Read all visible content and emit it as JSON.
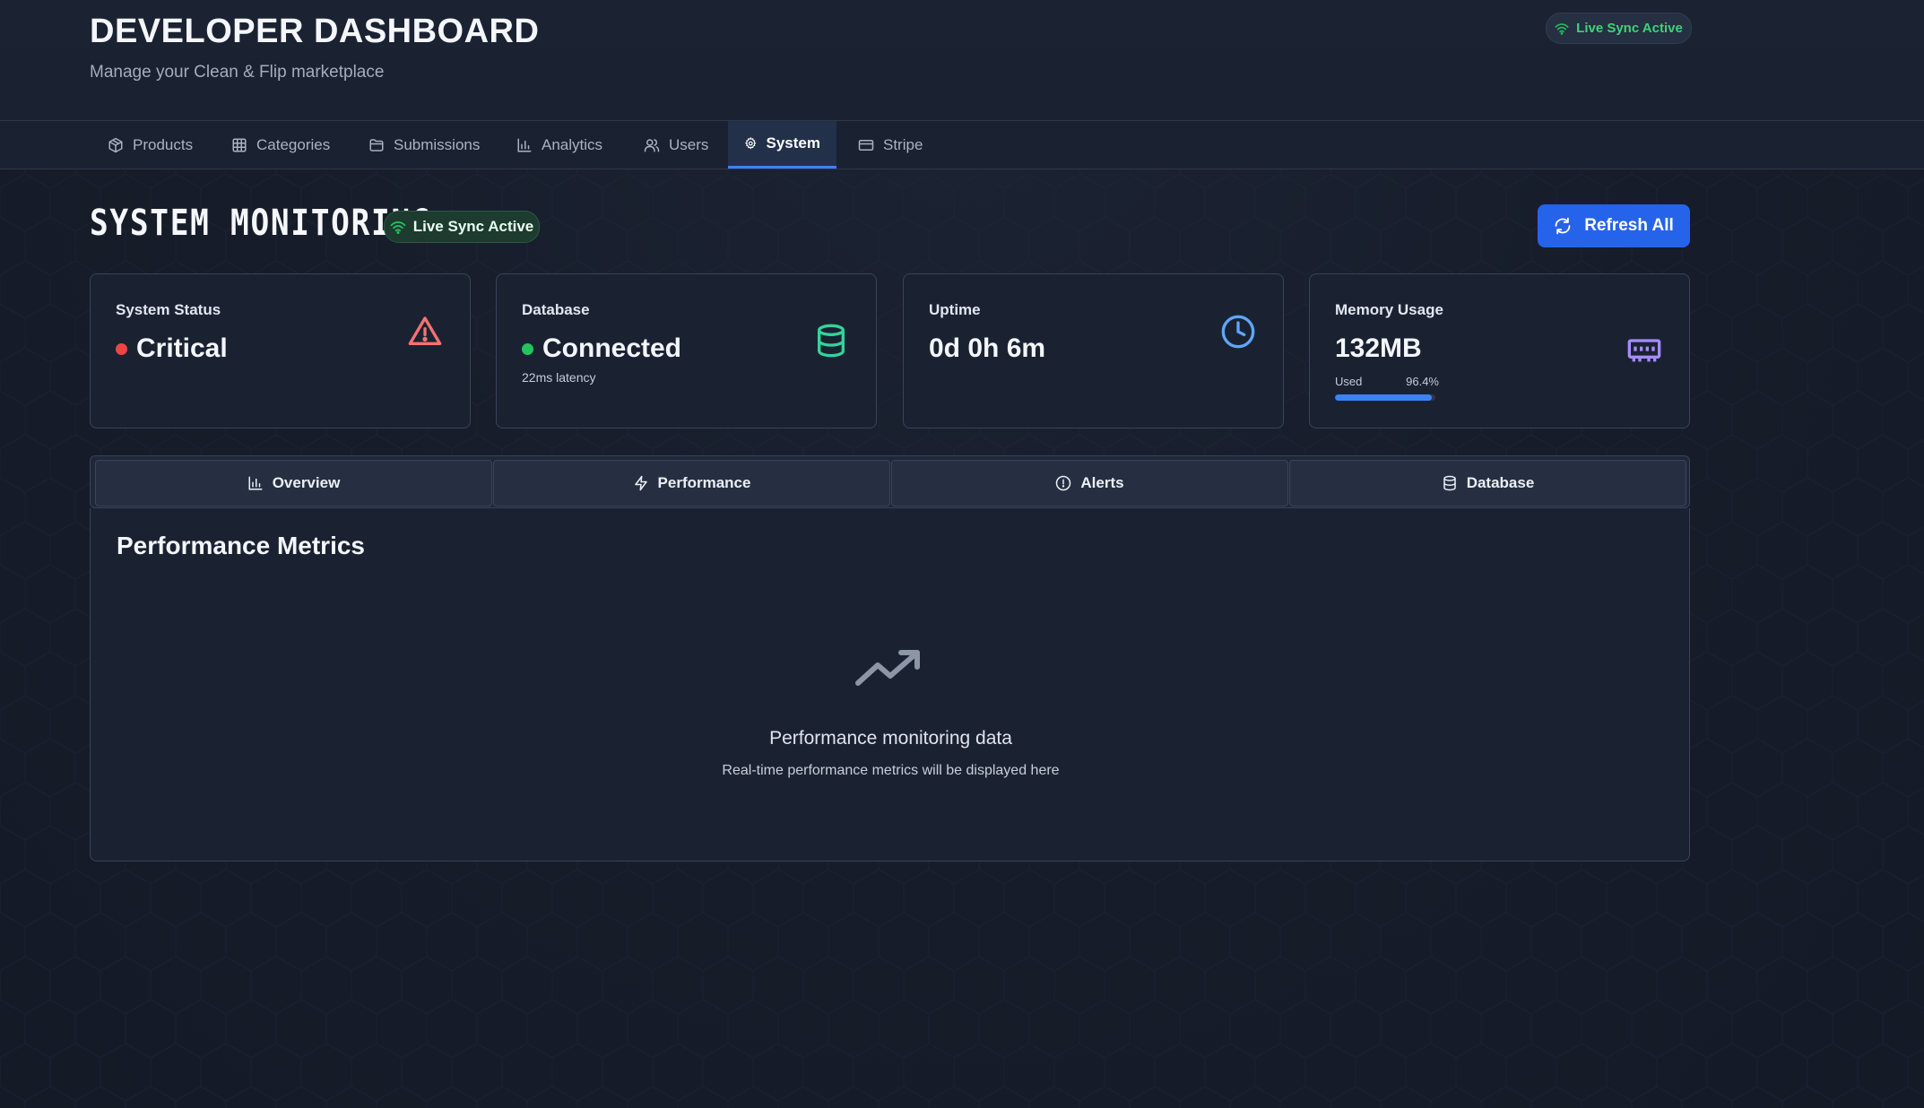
{
  "header": {
    "title": "DEVELOPER DASHBOARD",
    "subtitle": "Manage your Clean & Flip marketplace",
    "sync_pill": "Live Sync Active"
  },
  "nav": {
    "items": [
      {
        "label": "Products",
        "icon": "package-icon"
      },
      {
        "label": "Categories",
        "icon": "grid-icon"
      },
      {
        "label": "Submissions",
        "icon": "folder-icon"
      },
      {
        "label": "Analytics",
        "icon": "bar-chart-icon"
      },
      {
        "label": "Users",
        "icon": "users-icon"
      },
      {
        "label": "System",
        "icon": "gear-icon",
        "active": true
      },
      {
        "label": "Stripe",
        "icon": "credit-card-icon"
      }
    ]
  },
  "section": {
    "title": "SYSTEM MONITORING",
    "sync_pill": "Live Sync Active",
    "refresh_label": "Refresh All"
  },
  "cards": {
    "status": {
      "label": "System Status",
      "value": "Critical",
      "dot_color": "#ef4444",
      "icon": "alert-triangle-icon"
    },
    "database": {
      "label": "Database",
      "value": "Connected",
      "note": "22ms latency",
      "dot_color": "#22c55e",
      "icon": "database-icon"
    },
    "uptime": {
      "label": "Uptime",
      "value": "0d 0h 6m",
      "icon": "clock-icon"
    },
    "memory": {
      "label": "Memory Usage",
      "value": "132MB",
      "used_label": "Used",
      "used_percent": "96.4%",
      "fill_fraction": 0.964,
      "icon": "memory-chip-icon"
    }
  },
  "tabs": [
    {
      "label": "Overview",
      "icon": "bar-chart-icon"
    },
    {
      "label": "Performance",
      "icon": "zap-icon"
    },
    {
      "label": "Alerts",
      "icon": "alert-circle-icon"
    },
    {
      "label": "Database",
      "icon": "database-icon"
    }
  ],
  "panel": {
    "title": "Performance Metrics",
    "empty_icon": "trending-up-icon",
    "empty_title": "Performance monitoring data",
    "empty_subtitle": "Real-time performance metrics will be displayed here"
  },
  "colors": {
    "accent": "#2563eb",
    "success": "#22c55e",
    "danger": "#ef4444",
    "warning_icon": "#f87171",
    "db_icon": "#34d399",
    "clock_icon": "#60a5fa",
    "memory_icon": "#a78bfa"
  }
}
